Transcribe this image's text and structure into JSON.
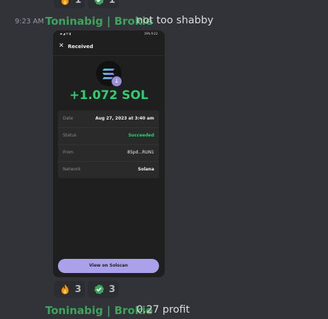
{
  "top_reactions": [
    {
      "emoji": "fire-emoji",
      "count": "1"
    },
    {
      "emoji": "check-emoji",
      "count": "1"
    }
  ],
  "message1": {
    "timestamp": "9:23 AM",
    "username": "Toninabig | Brokie",
    "text": "not too shabby"
  },
  "phone": {
    "status_time": "19% 9:22",
    "header_title": "Received",
    "amount": "+1.072 SOL",
    "details": [
      {
        "label": "Date",
        "value": "Aug 27, 2023 at 3:40 am"
      },
      {
        "label": "Status",
        "value": "Succeeded"
      },
      {
        "label": "From",
        "value": "85pd...RUN1"
      },
      {
        "label": "Network",
        "value": "Solana"
      }
    ],
    "button": "View on Solscan"
  },
  "reactions": [
    {
      "emoji": "fire-emoji",
      "count": "3"
    },
    {
      "emoji": "check-emoji",
      "count": "3"
    }
  ],
  "message2": {
    "username": "Toninabig | Brokie",
    "text": "0.27 profit"
  },
  "colors": {
    "background": "#313338",
    "username": "#3ba55c",
    "success": "#2fcf6f",
    "button": "#aba1ea"
  }
}
